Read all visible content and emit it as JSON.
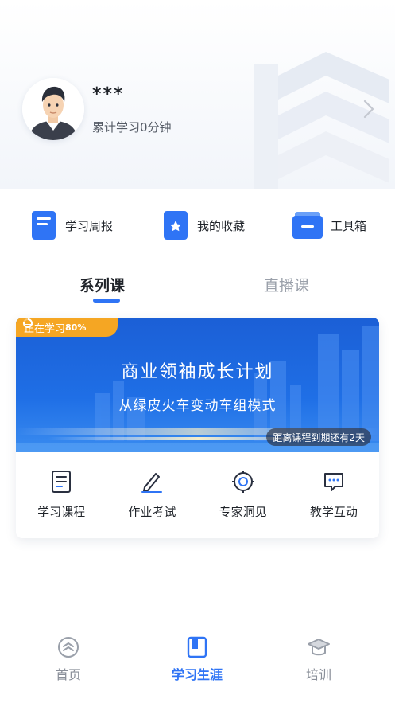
{
  "profile": {
    "name": "***",
    "study_time": "累计学习0分钟"
  },
  "quick_links": [
    {
      "label": "学习周报",
      "icon": "document-icon"
    },
    {
      "label": "我的收藏",
      "icon": "star-bookmark-icon"
    },
    {
      "label": "工具箱",
      "icon": "toolbox-icon"
    }
  ],
  "tabs": [
    {
      "label": "系列课",
      "active": true
    },
    {
      "label": "直播课",
      "active": false
    }
  ],
  "course": {
    "status": "正在学习",
    "progress": "80%",
    "title": "商业领袖成长计划",
    "subtitle": "从绿皮火车变动车组模式",
    "deadline": "距离课程到期还有2天",
    "actions": [
      {
        "label": "学习课程",
        "icon": "course-list-icon"
      },
      {
        "label": "作业考试",
        "icon": "pencil-icon"
      },
      {
        "label": "专家洞见",
        "icon": "target-icon"
      },
      {
        "label": "教学互动",
        "icon": "chat-bubble-icon"
      }
    ]
  },
  "tabbar": [
    {
      "label": "首页",
      "icon": "home-icon",
      "active": false
    },
    {
      "label": "学习生涯",
      "icon": "book-icon",
      "active": true
    },
    {
      "label": "培训",
      "icon": "graduation-cap-icon",
      "active": false
    }
  ],
  "colors": {
    "accent": "#2f74f5",
    "badge": "#f5a623",
    "banner": "#1a5fd8"
  }
}
